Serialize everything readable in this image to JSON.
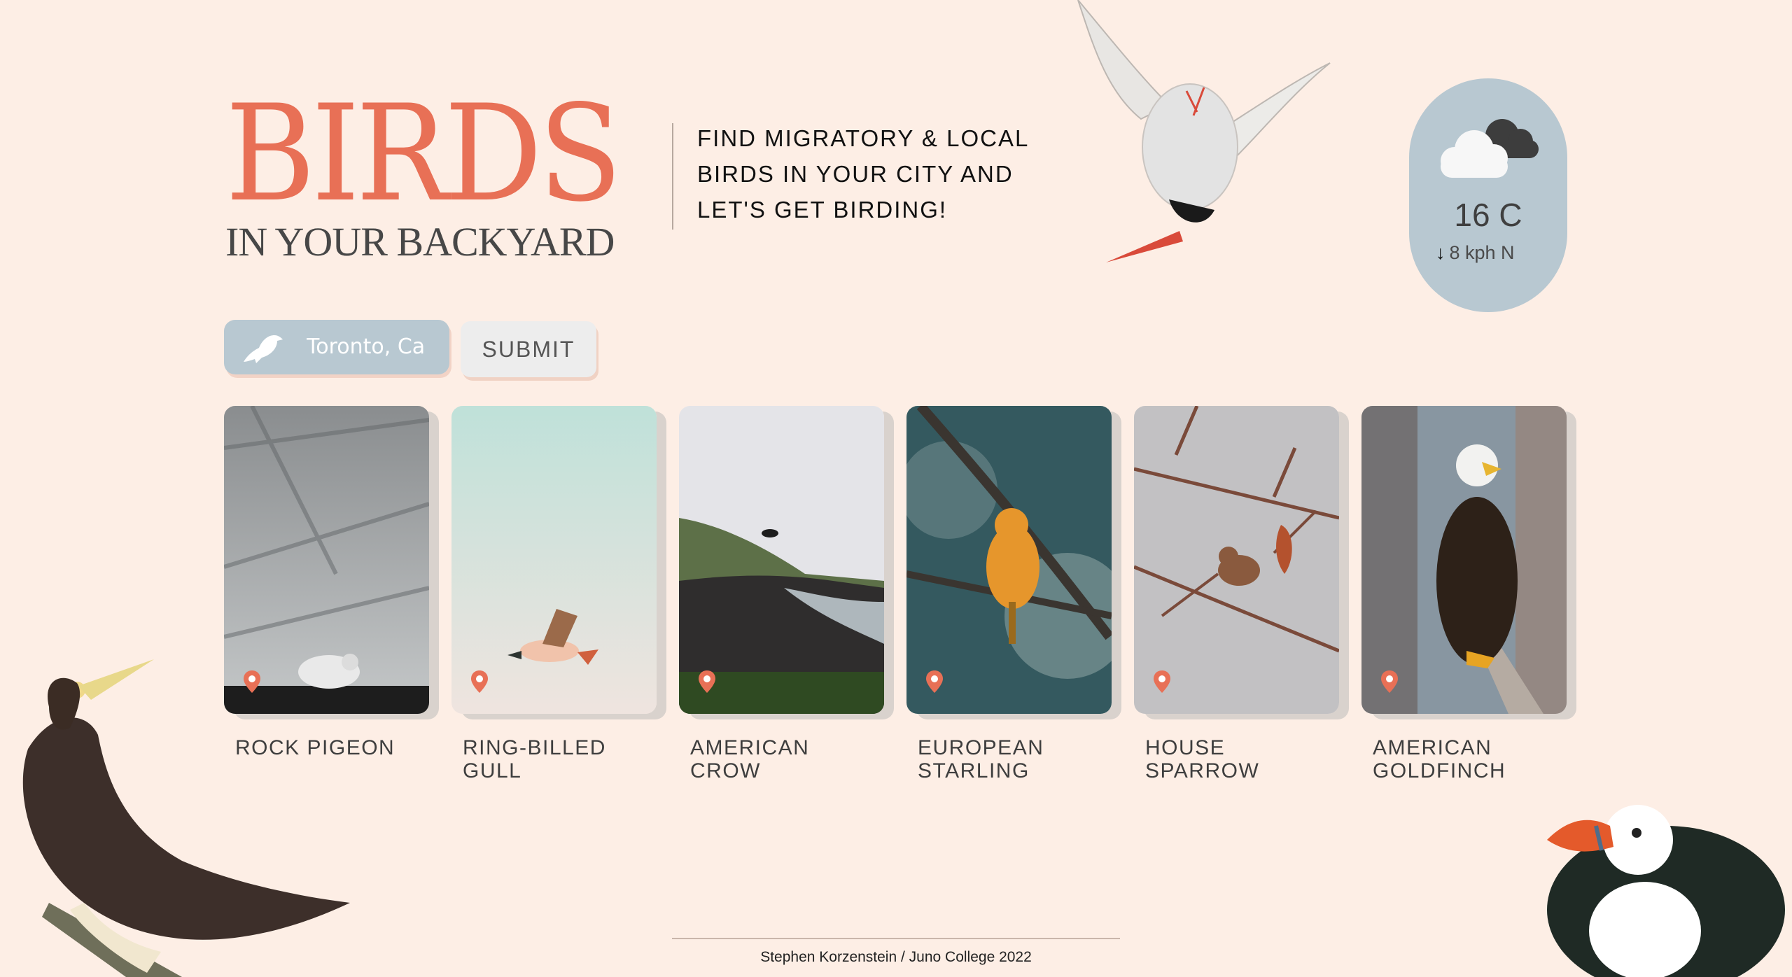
{
  "header": {
    "title": "BIRDS",
    "subtitle": "IN YOUR BACKYARD",
    "tagline_lines": [
      "FIND MIGRATORY & LOCAL",
      "BIRDS IN YOUR CITY AND",
      "LET'S GET BIRDING!"
    ]
  },
  "weather": {
    "temperature": "16 C",
    "wind_arrow": "↓",
    "wind": "8 kph N",
    "icon": "cloud-icon"
  },
  "search": {
    "value": "Toronto, Ca",
    "icon": "crow-icon",
    "submit_label": "SUBMIT"
  },
  "birds": [
    {
      "name": "ROCK PIGEON"
    },
    {
      "name": "RING-BILLED GULL"
    },
    {
      "name": "AMERICAN CROW"
    },
    {
      "name": "EUROPEAN STARLING"
    },
    {
      "name": "HOUSE SPARROW"
    },
    {
      "name": "AMERICAN GOLDFINCH"
    }
  ],
  "footer": {
    "credit": "Stephen Korzenstein / Juno College 2022"
  },
  "colors": {
    "background": "#fdeee5",
    "accent": "#e87056",
    "weather_panel": "#b8c8d1"
  }
}
